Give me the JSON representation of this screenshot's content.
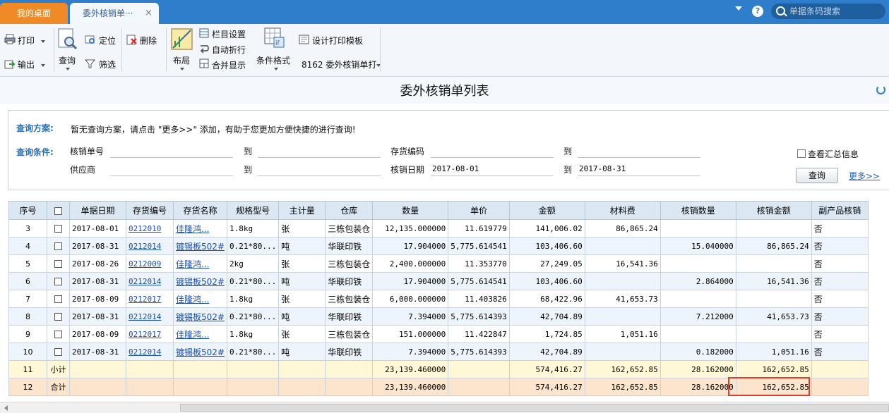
{
  "tabs": {
    "home": "我的桌面",
    "active": "委外核销单···",
    "close": "×",
    "search_placeholder": "单据条码搜索",
    "help": "?"
  },
  "toolbar": {
    "print": "打印",
    "export": "输出",
    "query": "查询",
    "locate": "定位",
    "filter": "筛选",
    "delete": "删除",
    "layout": "布局",
    "column_settings": "栏目设置",
    "auto_wrap": "自动折行",
    "merge_display": "合并显示",
    "conditional_format": "条件格式",
    "design_print_template": "设计打印模板",
    "template_select": "8162 委外核销单打"
  },
  "page": {
    "title": "委外核销单列表"
  },
  "query": {
    "scheme_label": "查询方案:",
    "scheme_hint": "暂无查询方案，请点击 \"更多>>\" 添加，有助于您更加方便快捷的进行查询!",
    "condition_label": "查询条件:",
    "field1": "核销单号",
    "to": "到",
    "field2": "存货编码",
    "field3": "供应商",
    "field4": "核销日期",
    "date_from": "2017-08-01",
    "date_to": "2017-08-31",
    "summary_checkbox": "查看汇总信息",
    "query_button": "查询",
    "more_link": "更多>>"
  },
  "grid": {
    "columns": [
      "序号",
      "",
      "单据日期",
      "存货编号",
      "存货名称",
      "规格型号",
      "主计量",
      "仓库",
      "数量",
      "单价",
      "金额",
      "材料费",
      "核销数量",
      "核销金额",
      "副产品核销"
    ],
    "rows": [
      [
        "3",
        "",
        "2017-08-01",
        "0212010",
        "佳隆鸿...",
        "1.8kg",
        "张",
        "三栋包装仓",
        "12,135.000000",
        "11.619779",
        "141,006.02",
        "86,865.24",
        "",
        "",
        "否"
      ],
      [
        "4",
        "",
        "2017-08-31",
        "0212014",
        "镀锡板502#",
        "0.21*80...",
        "吨",
        "华联印铁",
        "17.904000",
        "5,775.614541",
        "103,406.60",
        "",
        "15.040000",
        "86,865.24",
        "否"
      ],
      [
        "5",
        "",
        "2017-08-26",
        "0212009",
        "佳隆鸿...",
        "2kg",
        "张",
        "三栋包装仓",
        "2,400.000000",
        "11.353770",
        "27,249.05",
        "16,541.36",
        "",
        "",
        "否"
      ],
      [
        "6",
        "",
        "2017-08-31",
        "0212014",
        "镀锡板502#",
        "0.21*80...",
        "吨",
        "华联印铁",
        "17.904000",
        "5,775.614541",
        "103,406.60",
        "",
        "2.864000",
        "16,541.36",
        "否"
      ],
      [
        "7",
        "",
        "2017-08-09",
        "0212017",
        "佳隆鸿...",
        "1.8kg",
        "张",
        "三栋包装仓",
        "6,000.000000",
        "11.403826",
        "68,422.96",
        "41,653.73",
        "",
        "",
        "否"
      ],
      [
        "8",
        "",
        "2017-08-31",
        "0212014",
        "镀锡板502#",
        "0.21*80...",
        "吨",
        "华联印铁",
        "7.394000",
        "5,775.614393",
        "42,704.89",
        "",
        "7.212000",
        "41,653.73",
        "否"
      ],
      [
        "9",
        "",
        "2017-08-09",
        "0212017",
        "佳隆鸿...",
        "1.8kg",
        "张",
        "三栋包装仓",
        "151.000000",
        "11.422847",
        "1,724.85",
        "1,051.16",
        "",
        "",
        "否"
      ],
      [
        "10",
        "",
        "2017-08-31",
        "0212014",
        "镀锡板502#",
        "0.21*80...",
        "吨",
        "华联印铁",
        "7.394000",
        "5,775.614393",
        "42,704.89",
        "",
        "0.182000",
        "1,051.16",
        "否"
      ]
    ],
    "subtotal": [
      "11",
      "小计",
      "",
      "",
      "",
      "",
      "",
      "",
      "23,139.460000",
      "",
      "574,416.27",
      "162,652.85",
      "28.162000",
      "162,652.85",
      ""
    ],
    "total": [
      "12",
      "合计",
      "",
      "",
      "",
      "",
      "",
      "",
      "23,139.460000",
      "",
      "574,416.27",
      "162,652.85",
      "28.162000",
      "162,652.85",
      ""
    ]
  },
  "colors": {
    "topbar": "#2f7ecb",
    "home_tab": "#f08a24",
    "highlight": "#e03b2c"
  }
}
